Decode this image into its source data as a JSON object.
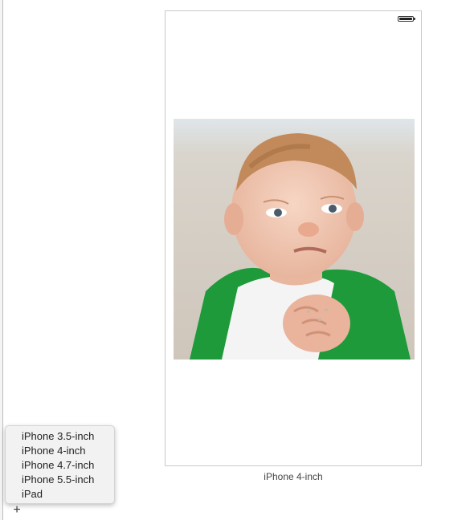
{
  "canvas": {
    "device_label": "iPhone 4-inch"
  },
  "menu": {
    "items": [
      {
        "label": "iPhone 3.5-inch"
      },
      {
        "label": "iPhone 4-inch"
      },
      {
        "label": "iPhone 4.7-inch"
      },
      {
        "label": "iPhone 5.5-inch"
      },
      {
        "label": "iPad"
      }
    ]
  },
  "toolbar": {
    "add_symbol": "+"
  },
  "icons": {
    "battery": "battery-icon",
    "add": "plus-icon"
  }
}
